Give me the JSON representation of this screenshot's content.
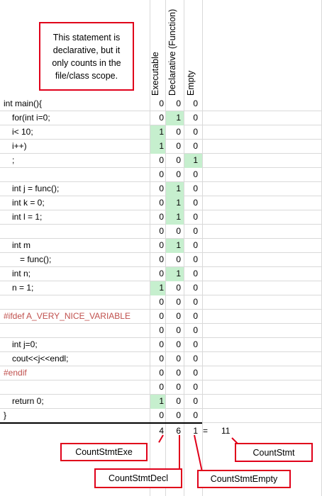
{
  "headers": {
    "exe": "Executable",
    "decl": "Declarative (Function)",
    "empty": "Empty"
  },
  "note": "This statement is declarative, but it only counts in the file/class scope.",
  "rows": [
    {
      "code": "int main(){",
      "indent": 0,
      "color": "black",
      "exe": "0",
      "decl": "0",
      "empty": "0",
      "hl": ""
    },
    {
      "code": "for(int i=0;",
      "indent": 1,
      "color": "black",
      "exe": "0",
      "decl": "1",
      "empty": "0",
      "hl": "decl"
    },
    {
      "code": "i< 10;",
      "indent": 1,
      "color": "black",
      "exe": "1",
      "decl": "0",
      "empty": "0",
      "hl": "exe"
    },
    {
      "code": "i++)",
      "indent": 1,
      "color": "black",
      "exe": "1",
      "decl": "0",
      "empty": "0",
      "hl": "exe"
    },
    {
      "code": ";",
      "indent": 1,
      "color": "black",
      "exe": "0",
      "decl": "0",
      "empty": "1",
      "hl": "empty"
    },
    {
      "code": "",
      "indent": 0,
      "color": "black",
      "exe": "0",
      "decl": "0",
      "empty": "0",
      "hl": ""
    },
    {
      "code": "int j = func();",
      "indent": 1,
      "color": "black",
      "exe": "0",
      "decl": "1",
      "empty": "0",
      "hl": "decl"
    },
    {
      "code": "int k = 0;",
      "indent": 1,
      "color": "black",
      "exe": "0",
      "decl": "1",
      "empty": "0",
      "hl": "decl"
    },
    {
      "code": "int l = 1;",
      "indent": 1,
      "color": "black",
      "exe": "0",
      "decl": "1",
      "empty": "0",
      "hl": "decl"
    },
    {
      "code": "",
      "indent": 0,
      "color": "black",
      "exe": "0",
      "decl": "0",
      "empty": "0",
      "hl": ""
    },
    {
      "code": "int m",
      "indent": 1,
      "color": "black",
      "exe": "0",
      "decl": "1",
      "empty": "0",
      "hl": "decl"
    },
    {
      "code": "= func();",
      "indent": 2,
      "color": "black",
      "exe": "0",
      "decl": "0",
      "empty": "0",
      "hl": ""
    },
    {
      "code": "int n;",
      "indent": 1,
      "color": "black",
      "exe": "0",
      "decl": "1",
      "empty": "0",
      "hl": "decl"
    },
    {
      "code": "n = 1;",
      "indent": 1,
      "color": "black",
      "exe": "1",
      "decl": "0",
      "empty": "0",
      "hl": "exe"
    },
    {
      "code": "",
      "indent": 0,
      "color": "black",
      "exe": "0",
      "decl": "0",
      "empty": "0",
      "hl": ""
    },
    {
      "code": "#ifdef A_VERY_NICE_VARIABLE",
      "indent": 0,
      "color": "red",
      "exe": "0",
      "decl": "0",
      "empty": "0",
      "hl": ""
    },
    {
      "code": "",
      "indent": 0,
      "color": "black",
      "exe": "0",
      "decl": "0",
      "empty": "0",
      "hl": ""
    },
    {
      "code": "int j=0;",
      "indent": 1,
      "color": "black",
      "exe": "0",
      "decl": "0",
      "empty": "0",
      "hl": ""
    },
    {
      "code": "cout<<j<<endl;",
      "indent": 1,
      "color": "black",
      "exe": "0",
      "decl": "0",
      "empty": "0",
      "hl": ""
    },
    {
      "code": "#endif",
      "indent": 0,
      "color": "red",
      "exe": "0",
      "decl": "0",
      "empty": "0",
      "hl": ""
    },
    {
      "code": "",
      "indent": 0,
      "color": "black",
      "exe": "0",
      "decl": "0",
      "empty": "0",
      "hl": ""
    },
    {
      "code": "return 0;",
      "indent": 1,
      "color": "black",
      "exe": "1",
      "decl": "0",
      "empty": "0",
      "hl": "exe"
    },
    {
      "code": "}",
      "indent": 0,
      "color": "black",
      "exe": "0",
      "decl": "0",
      "empty": "0",
      "hl": ""
    }
  ],
  "totals": {
    "exe": "4",
    "decl": "6",
    "empty": "1",
    "equals": "=",
    "sum": "11"
  },
  "labels": {
    "exe": "CountStmtExe",
    "decl": "CountStmtDecl",
    "empty": "CountStmtEmpty",
    "sum": "CountStmt"
  },
  "colors": {
    "highlight": "#c6efce",
    "callout_border": "#e0001a",
    "directive": "#c0504d"
  }
}
